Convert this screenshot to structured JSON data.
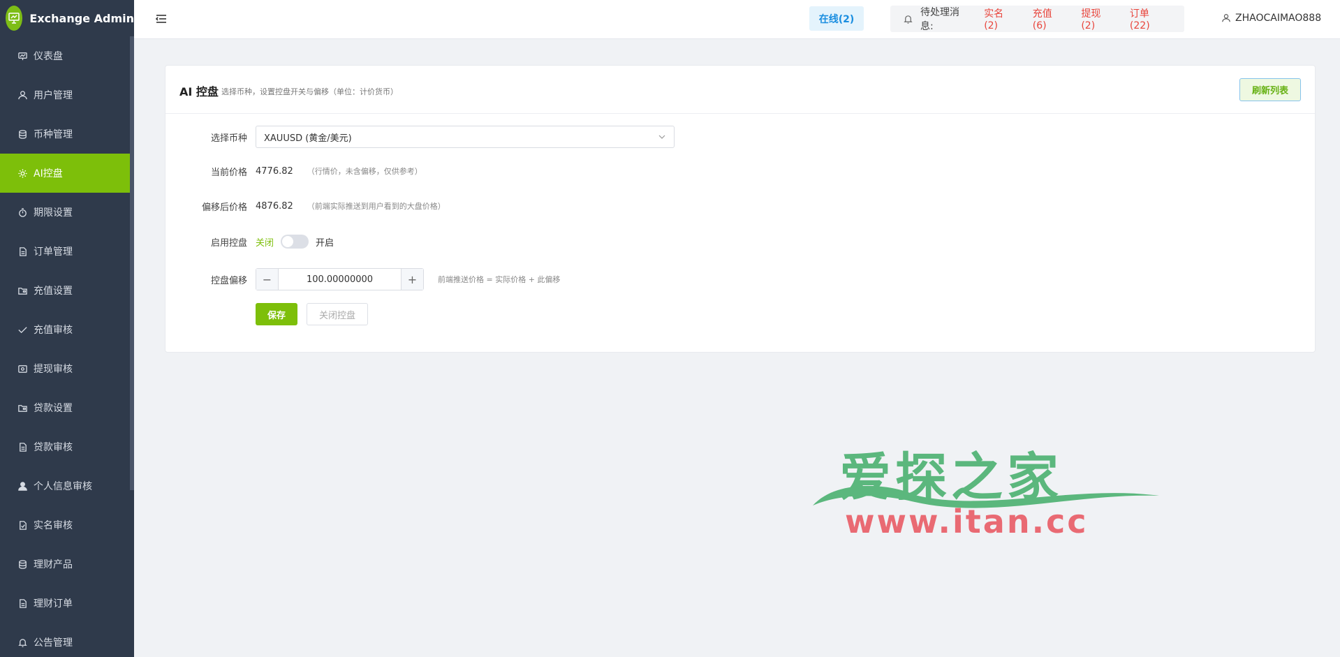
{
  "brand": {
    "title": "Exchange Admin",
    "logo_icon": "presentation-chart-icon",
    "logo_color": "#7dbd16"
  },
  "sidebar": {
    "items": [
      {
        "label": "仪表盘",
        "icon": "dashboard-icon",
        "active": false
      },
      {
        "label": "用户管理",
        "icon": "user-icon",
        "active": false
      },
      {
        "label": "币种管理",
        "icon": "database-icon",
        "active": false
      },
      {
        "label": "AI控盘",
        "icon": "gear-icon",
        "active": true
      },
      {
        "label": "期限设置",
        "icon": "stopwatch-icon",
        "active": false
      },
      {
        "label": "订单管理",
        "icon": "document-icon",
        "active": false
      },
      {
        "label": "充值设置",
        "icon": "folder-icon",
        "active": false
      },
      {
        "label": "充值审核",
        "icon": "check-icon",
        "active": false
      },
      {
        "label": "提现审核",
        "icon": "wallet-icon",
        "active": false
      },
      {
        "label": "贷款设置",
        "icon": "folder-icon",
        "active": false
      },
      {
        "label": "贷款审核",
        "icon": "document-icon",
        "active": false
      },
      {
        "label": "个人信息审核",
        "icon": "person-filled-icon",
        "active": false
      },
      {
        "label": "实名审核",
        "icon": "document-check-icon",
        "active": false
      },
      {
        "label": "理财产品",
        "icon": "database-icon",
        "active": false
      },
      {
        "label": "理财订单",
        "icon": "document-icon",
        "active": false
      },
      {
        "label": "公告管理",
        "icon": "bell-icon",
        "active": false
      }
    ],
    "accent_color": "#7dbf0a",
    "bg_color": "#2f3a4b"
  },
  "header": {
    "online": "在线(2)",
    "pending_label": "待处理消息:",
    "pending_links": [
      "实名(2)",
      "充值(6)",
      "提现(2)",
      "订单(22)"
    ],
    "username": "ZHAOCAIMAO888"
  },
  "card": {
    "title": "AI 控盘",
    "subtitle": "选择币种，设置控盘开关与偏移（单位：计价货币）",
    "refresh_label": "刷新列表",
    "symbol_label": "选择币种",
    "symbol_value": "XAUUSD (黄金/美元)",
    "current_price_label": "当前价格",
    "current_price": "4776.82",
    "current_price_hint": "（行情价，未含偏移，仅供参考）",
    "offset_price_label": "偏移后价格",
    "offset_price": "4876.82",
    "offset_price_hint": "（前端实际推送到用户看到的大盘价格）",
    "enable_label": "启用控盘",
    "switch_off": "关闭",
    "switch_on": "开启",
    "switch_state": "off",
    "offset_label": "控盘偏移",
    "offset_value": "100.00000000",
    "offset_hint": "前端推送价格 = 实际价格 + 此偏移",
    "save_label": "保存",
    "close_label": "关闭控盘"
  },
  "watermark": {
    "cn": "爱探之家",
    "url": "www.itan.cc"
  }
}
